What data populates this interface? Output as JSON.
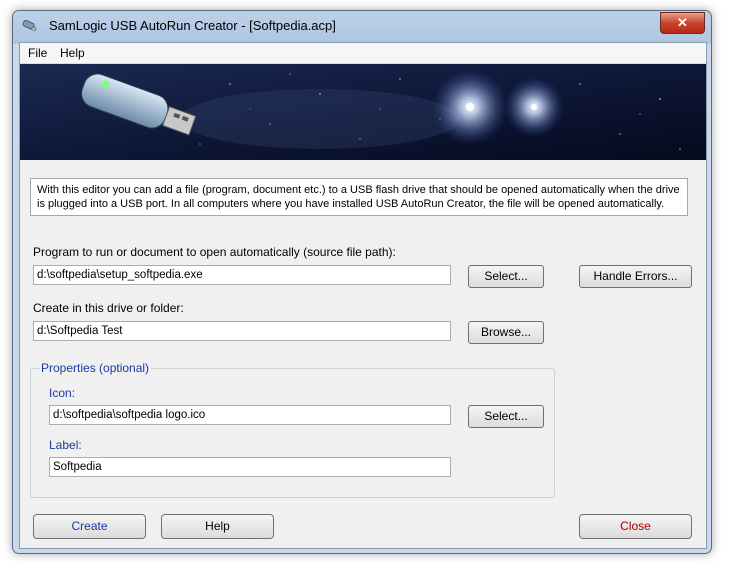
{
  "window": {
    "title": "SamLogic USB AutoRun Creator - [Softpedia.acp]",
    "close_glyph": "✕"
  },
  "menu": {
    "file": "File",
    "help": "Help"
  },
  "info_text": "With this editor you can add a file (program, document etc.) to a USB flash drive that should be opened automatically when the drive is plugged into a USB port. In all computers where you have installed USB AutoRun Creator, the file will be opened automatically.",
  "source": {
    "label": "Program to run or document to open automatically (source file path):",
    "value": "d:\\softpedia\\setup_softpedia.exe",
    "button": "Select..."
  },
  "handle_errors": "Handle Errors...",
  "target": {
    "label": "Create in this drive or folder:",
    "value": "d:\\Softpedia  Test",
    "button": "Browse..."
  },
  "properties": {
    "title": "Properties (optional)",
    "icon_label": "Icon:",
    "icon_value": "d:\\softpedia\\softpedia logo.ico",
    "icon_button": "Select...",
    "label_label": "Label:",
    "label_value": "Softpedia"
  },
  "buttons": {
    "create": "Create",
    "help": "Help",
    "close": "Close"
  },
  "colors": {
    "accent": "#1a3aa0",
    "close_text": "#b00000",
    "window_frame": "#c9d8ea"
  }
}
